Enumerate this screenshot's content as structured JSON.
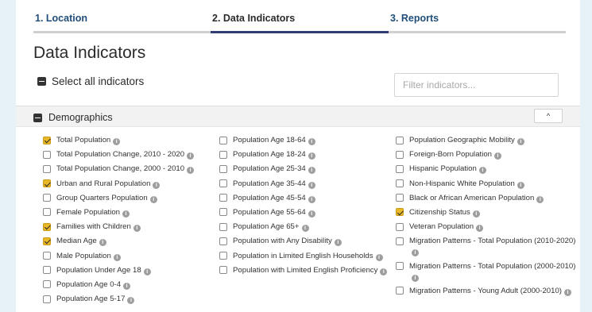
{
  "steps": [
    {
      "label": "1. Location",
      "active": false
    },
    {
      "label": "2. Data Indicators",
      "active": true
    },
    {
      "label": "3. Reports",
      "active": false
    }
  ],
  "page_title": "Data Indicators",
  "select_all_label": "Select all indicators",
  "filter_placeholder": "Filter indicators...",
  "section": {
    "title": "Demographics",
    "collapse_symbol": "^"
  },
  "icons": {
    "info": "info-circle-icon",
    "collapse": "chevron-up-icon"
  },
  "colors": {
    "active_step": "#2f3d74",
    "checkbox_checked": "#e8b828",
    "background": "#e6f2f8"
  },
  "columns": [
    [
      {
        "label": "Total Population",
        "checked": true
      },
      {
        "label": "Total Population Change, 2010 - 2020",
        "checked": false
      },
      {
        "label": "Total Population Change, 2000 - 2010",
        "checked": false
      },
      {
        "label": "Urban and Rural Population",
        "checked": true
      },
      {
        "label": "Group Quarters Population",
        "checked": false
      },
      {
        "label": "Female Population",
        "checked": false
      },
      {
        "label": "Families with Children",
        "checked": true
      },
      {
        "label": "Median Age",
        "checked": true
      },
      {
        "label": "Male Population",
        "checked": false
      },
      {
        "label": "Population Under Age 18",
        "checked": false
      },
      {
        "label": "Population Age 0-4",
        "checked": false
      },
      {
        "label": "Population Age 5-17",
        "checked": false
      }
    ],
    [
      {
        "label": "Population Age 18-64",
        "checked": false
      },
      {
        "label": "Population Age 18-24",
        "checked": false
      },
      {
        "label": "Population Age 25-34",
        "checked": false
      },
      {
        "label": "Population Age 35-44",
        "checked": false
      },
      {
        "label": "Population Age 45-54",
        "checked": false
      },
      {
        "label": "Population Age 55-64",
        "checked": false
      },
      {
        "label": "Population Age 65+",
        "checked": false
      },
      {
        "label": "Population with Any Disability",
        "checked": false
      },
      {
        "label": "Population in Limited English Households",
        "checked": false
      },
      {
        "label": "Population with Limited English Proficiency",
        "checked": false
      }
    ],
    [
      {
        "label": "Population Geographic Mobility",
        "checked": false
      },
      {
        "label": "Foreign-Born Population",
        "checked": false
      },
      {
        "label": "Hispanic Population",
        "checked": false
      },
      {
        "label": "Non-Hispanic White Population",
        "checked": false
      },
      {
        "label": "Black or African American Population",
        "checked": false
      },
      {
        "label": "Citizenship Status",
        "checked": true
      },
      {
        "label": "Veteran Population",
        "checked": false
      },
      {
        "label": "Migration Patterns - Total Population (2010-2020)",
        "checked": false
      },
      {
        "label": "Migration Patterns - Total Population (2000-2010)",
        "checked": false
      },
      {
        "label": "Migration Patterns - Young Adult (2000-2010)",
        "checked": false
      }
    ]
  ]
}
